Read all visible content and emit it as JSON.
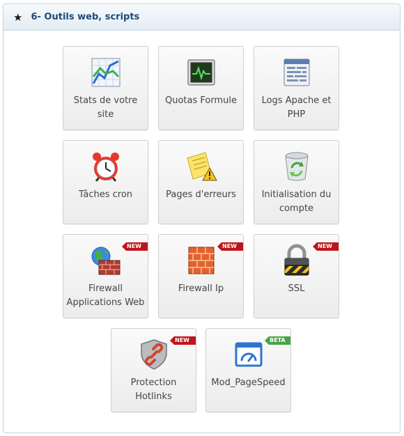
{
  "panel": {
    "title": "6- Outils web, scripts"
  },
  "tiles": [
    {
      "label": "Stats de votre site",
      "icon": "stats-chart-icon"
    },
    {
      "label": "Quotas Formule",
      "icon": "monitor-quota-icon"
    },
    {
      "label": "Logs Apache et PHP",
      "icon": "logs-document-icon"
    },
    {
      "label": "Tâches cron",
      "icon": "alarm-clock-icon"
    },
    {
      "label": "Pages d'erreurs",
      "icon": "warning-note-icon"
    },
    {
      "label": "Initialisation du compte",
      "icon": "recycle-bin-icon"
    },
    {
      "label": "Firewall Applications Web",
      "icon": "globe-firewall-icon",
      "badge": "NEW"
    },
    {
      "label": "Firewall Ip",
      "icon": "firewall-icon",
      "badge": "NEW"
    },
    {
      "label": "SSL",
      "icon": "padlock-icon",
      "badge": "NEW"
    },
    {
      "label": "Protection Hotlinks",
      "icon": "shield-link-icon",
      "badge": "NEW"
    },
    {
      "label": "Mod_PageSpeed",
      "icon": "speedometer-window-icon",
      "badge": "BETA"
    }
  ],
  "colors": {
    "header_text": "#1c4a79",
    "badge_new": "#c0141b",
    "badge_beta": "#47a346"
  }
}
